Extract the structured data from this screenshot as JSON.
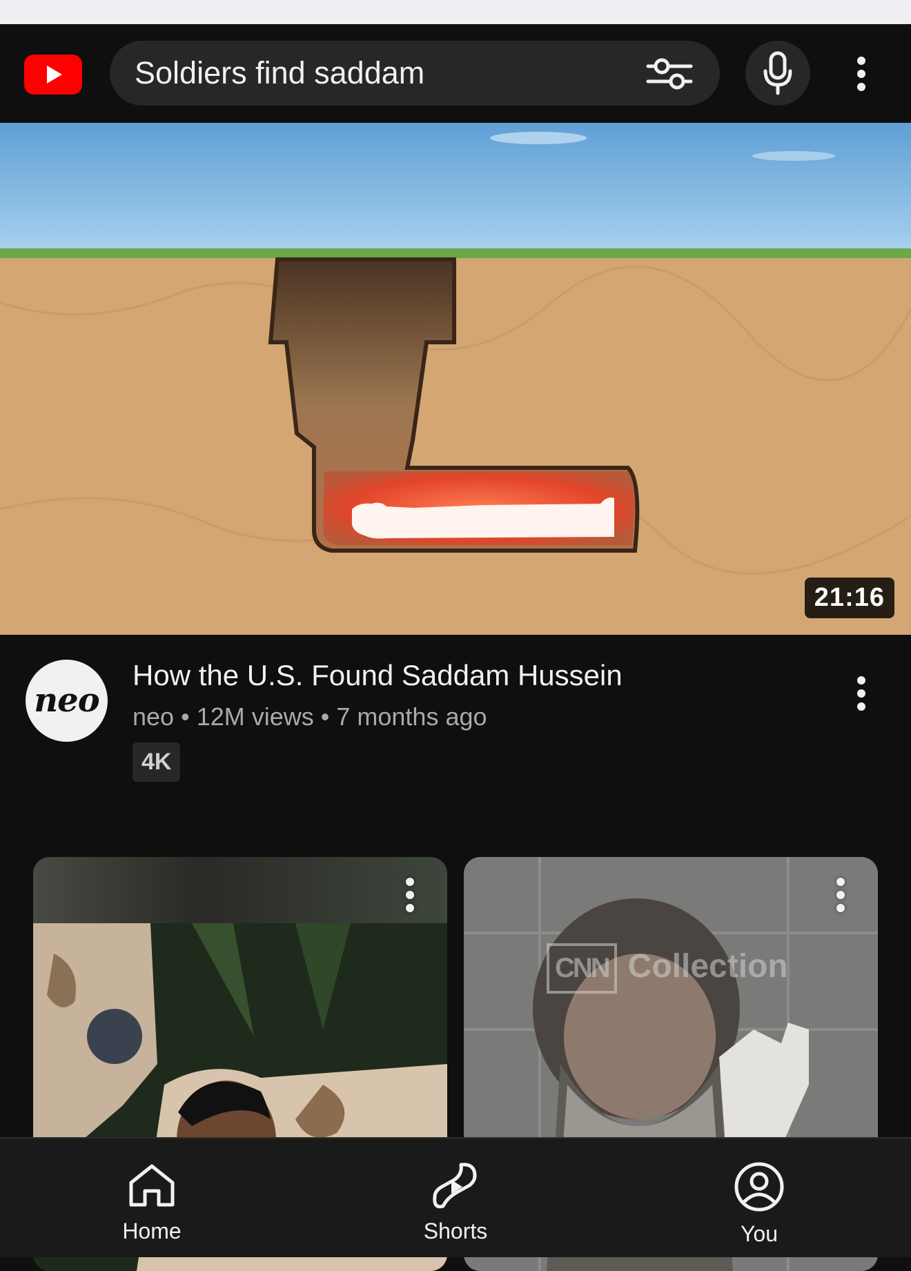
{
  "search": {
    "query": "Soldiers find saddam"
  },
  "icons": {
    "logo": "youtube-logo-icon",
    "filter": "filter-sliders-icon",
    "mic": "microphone-icon",
    "more": "more-vertical-icon",
    "home": "home-icon",
    "shorts": "shorts-icon",
    "you": "account-circle-icon"
  },
  "video": {
    "duration": "21:16",
    "title": "How the U.S. Found Saddam Hussein",
    "channel": "neo",
    "channel_avatar_text": "neo",
    "views": "12M views",
    "age": "7 months ago",
    "badge": "4K"
  },
  "shorts": [
    {
      "watermark": ""
    },
    {
      "watermark_logo": "CNN",
      "watermark": "Collection"
    }
  ],
  "nav": {
    "items": [
      {
        "label": "Home"
      },
      {
        "label": "Shorts"
      },
      {
        "label": "You"
      }
    ]
  },
  "colors": {
    "background": "#0f0f0f",
    "brand_red": "#ff0000",
    "surface": "#272727",
    "secondary_text": "#aaaaaa"
  }
}
